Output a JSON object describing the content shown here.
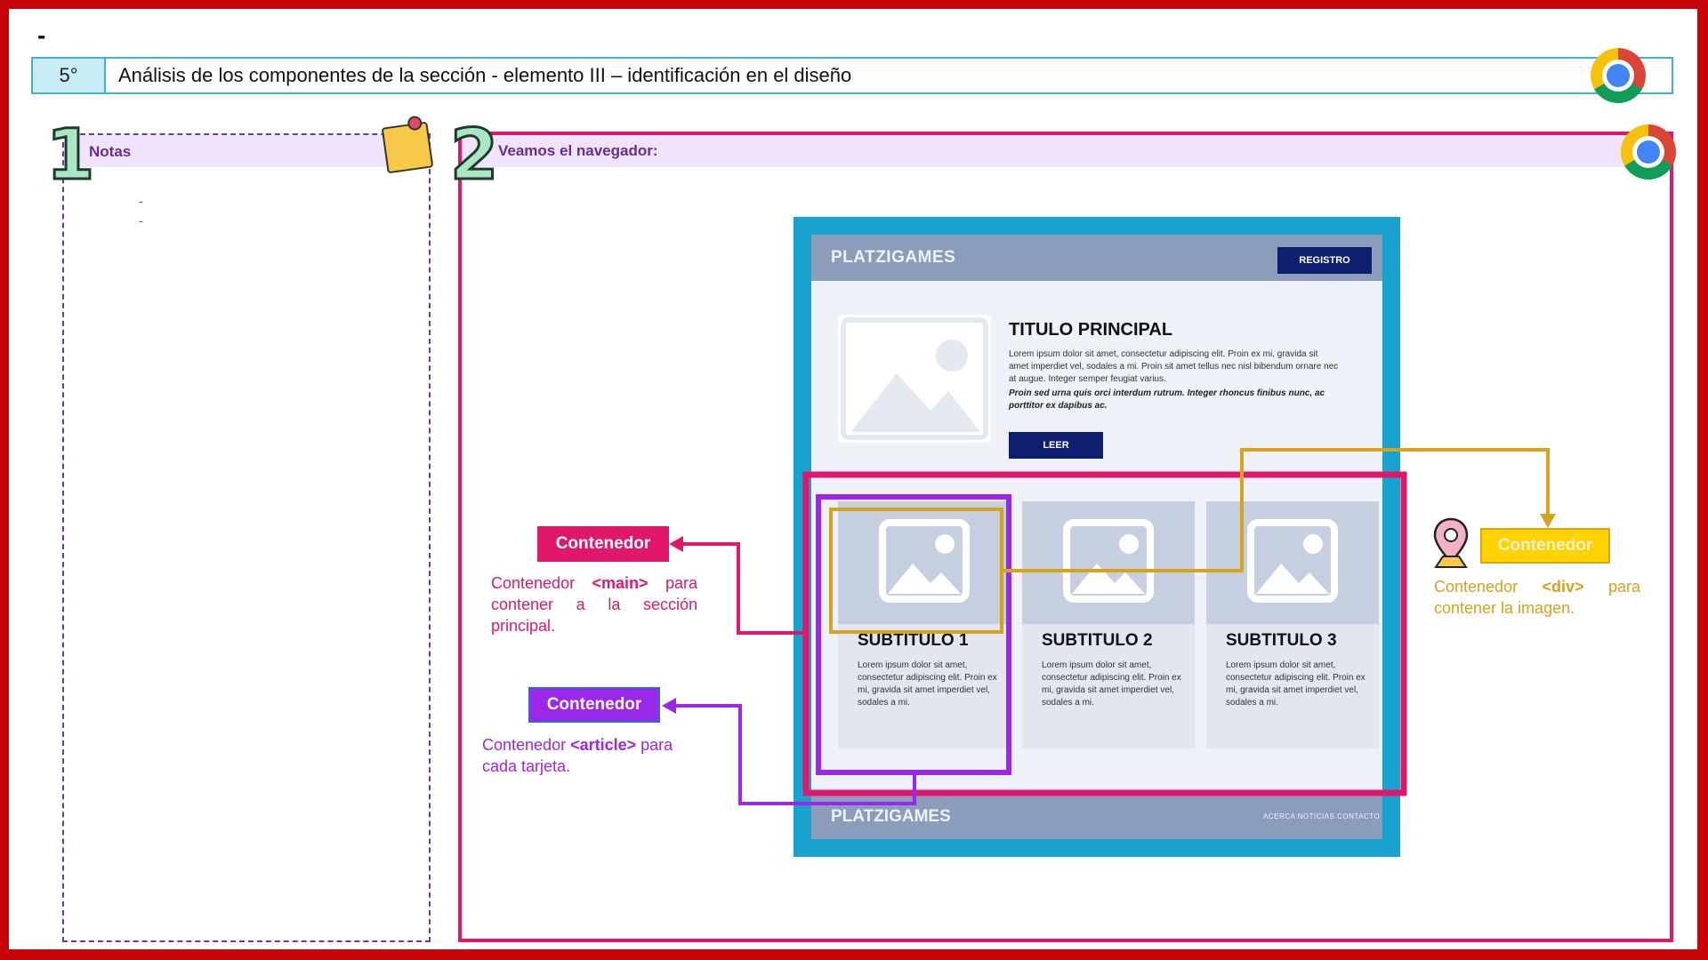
{
  "top_mark": "-",
  "header": {
    "step": "5°",
    "title": "Análisis de los componentes de la sección   - elemento III – identificación en el diseño"
  },
  "notes": {
    "number": "1",
    "label": "Notas",
    "lines": [
      "-",
      "-"
    ]
  },
  "browser": {
    "number": "2",
    "label": "Veamos el navegador:"
  },
  "mockup": {
    "logo": "PLATZIGAMES",
    "register_button": "REGISTRO",
    "hero_title": "TITULO PRINCIPAL",
    "hero_text": "Lorem ipsum dolor sit amet, consectetur adipiscing elit. Proin ex mi, gravida sit amet imperdiet vel, sodales a mi. Proin sit amet tellus nec nisl bibendum ornare nec at augue. Integer semper feugiat varius.",
    "hero_text_italic": "Proin sed urna quis orci interdum rutrum. Integer rhoncus finibus nunc, ac porttitor ex dapibus ac.",
    "read_button": "LEER",
    "cards": [
      {
        "title": "SUBTITULO 1",
        "text": "Lorem ipsum dolor sit amet, consectetur adipiscing elit. Proin ex mi, gravida sit amet imperdiet vel, sodales a mi."
      },
      {
        "title": "SUBTITULO 2",
        "text": "Lorem ipsum dolor sit amet, consectetur adipiscing elit. Proin ex mi, gravida sit amet imperdiet vel, sodales a mi."
      },
      {
        "title": "SUBTITULO 3",
        "text": "Lorem ipsum dolor sit amet, consectetur adipiscing elit. Proin ex mi, gravida sit amet imperdiet vel, sodales a mi."
      }
    ],
    "footer_logo": "PLATZIGAMES",
    "footer_links": "ACERCA  NOTICIAS  CONTACTO"
  },
  "annotations": {
    "main": {
      "label": "Contenedor",
      "desc_prefix": "Contenedor ",
      "tag": "<main>",
      "desc_suffix": " para contener a la sección principal.",
      "color": "#e0186b"
    },
    "article": {
      "label": "Contenedor",
      "desc_prefix": "Contenedor ",
      "tag": "<article>",
      "desc_suffix": " para cada tarjeta.",
      "color": "#9b27e8"
    },
    "div": {
      "label": "Contenedor",
      "desc_prefix": "Contenedor ",
      "tag": "<div>",
      "desc_suffix": " para contener la imagen.",
      "color": "#d7a21c"
    }
  },
  "icons": [
    "chrome-icon",
    "sticky-note-icon",
    "location-pin-icon",
    "image-placeholder-icon"
  ]
}
